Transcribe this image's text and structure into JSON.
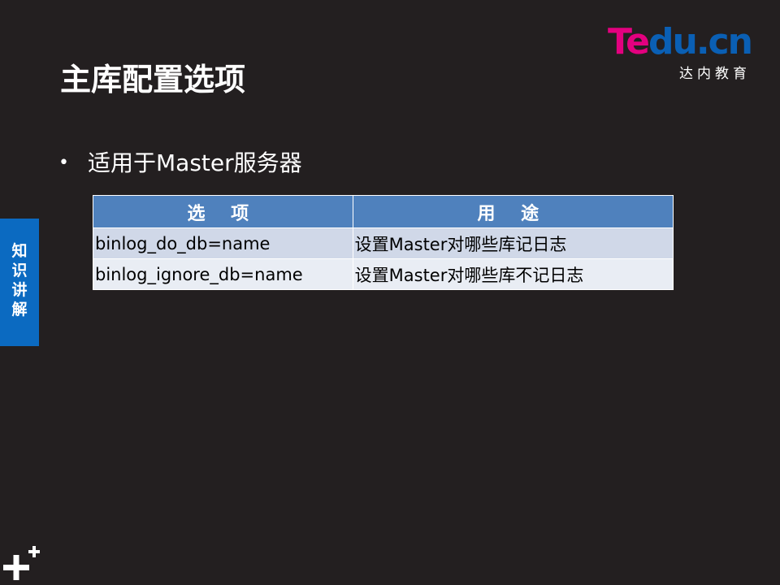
{
  "logo": {
    "main_pink": "Te",
    "main_blue": "du.cn",
    "sub": "达内教育",
    "colors": {
      "pink": "#e3007f",
      "blue": "#0a5fb4"
    }
  },
  "title": "主库配置选项",
  "bullet": {
    "symbol": "•",
    "text": "适用于Master服务器"
  },
  "side_tab": {
    "label": "知识讲解",
    "color": "#0b6ac1"
  },
  "table": {
    "headers": [
      "选 项",
      "用 途"
    ],
    "rows": [
      [
        "binlog_do_db=name",
        "设置Master对哪些库记日志"
      ],
      [
        "binlog_ignore_db=name",
        "设置Master对哪些库不记日志"
      ]
    ],
    "header_color": "#4f81bd"
  },
  "decor": {
    "corner_icon": "plus-icon"
  }
}
